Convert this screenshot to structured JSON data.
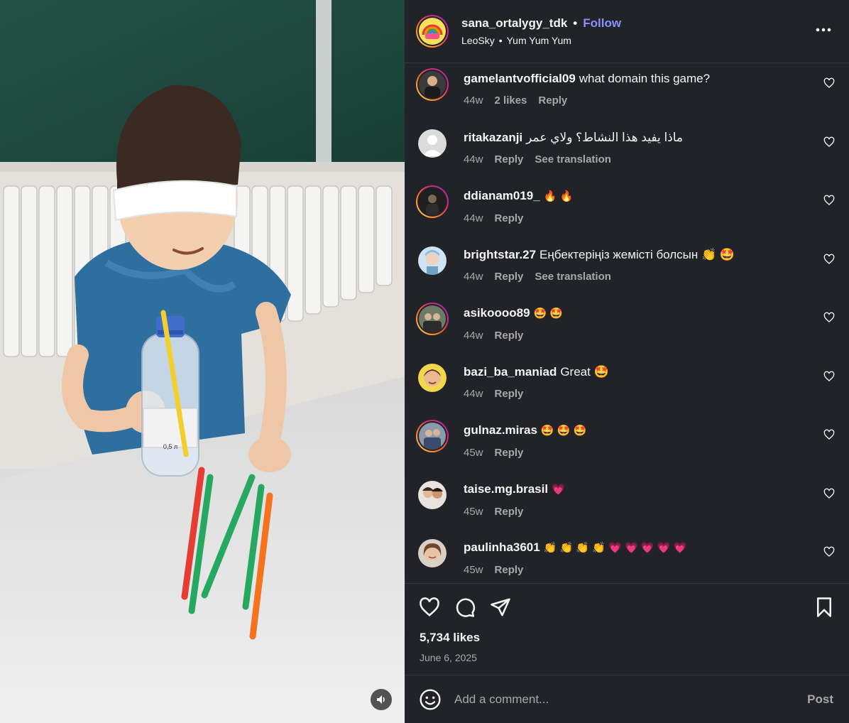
{
  "header": {
    "username": "sana_ortalygy_tdk",
    "separator": "•",
    "follow_label": "Follow",
    "audio_artist": "LeoSky",
    "audio_sep": "•",
    "audio_title": "Yum Yum Yum"
  },
  "media": {
    "bottle_label": "0,5 л",
    "mute_icon": "speaker-icon"
  },
  "comments": [
    {
      "user": "gamelantvofficial09",
      "text": "what domain this game?",
      "time": "44w",
      "likes": "2 likes",
      "reply": "Reply",
      "translation": ""
    },
    {
      "user": "ritakazanji",
      "text": "ماذا يفيد هذا النشاط؟ ولاي عمر",
      "time": "44w",
      "likes": "",
      "reply": "Reply",
      "translation": "See translation"
    },
    {
      "user": "ddianam019_",
      "text": "🔥 🔥",
      "time": "44w",
      "likes": "",
      "reply": "Reply",
      "translation": ""
    },
    {
      "user": "brightstar.27",
      "text": "Еңбектеріңіз жемісті болсын 👏 🤩",
      "time": "44w",
      "likes": "",
      "reply": "Reply",
      "translation": "See translation"
    },
    {
      "user": "asikoooo89",
      "text": "🤩 🤩",
      "time": "44w",
      "likes": "",
      "reply": "Reply",
      "translation": ""
    },
    {
      "user": "bazi_ba_maniad",
      "text": "Great 🤩",
      "time": "44w",
      "likes": "",
      "reply": "Reply",
      "translation": ""
    },
    {
      "user": "gulnaz.miras",
      "text": "🤩 🤩 🤩",
      "time": "45w",
      "likes": "",
      "reply": "Reply",
      "translation": ""
    },
    {
      "user": "taise.mg.brasil",
      "text": "💗",
      "time": "45w",
      "likes": "",
      "reply": "Reply",
      "translation": ""
    },
    {
      "user": "paulinha3601",
      "text": "👏 👏 👏 👏 💗 💗 💗 💗 💗",
      "time": "45w",
      "likes": "",
      "reply": "Reply",
      "translation": ""
    }
  ],
  "actions": {
    "likes": "5,734 likes",
    "date": "June 6, 2025"
  },
  "composer": {
    "placeholder": "Add a comment...",
    "post_label": "Post"
  },
  "colors": {
    "panel_bg": "#212328",
    "follow": "#8a92ff",
    "muted_text": "#a8a8a8"
  }
}
